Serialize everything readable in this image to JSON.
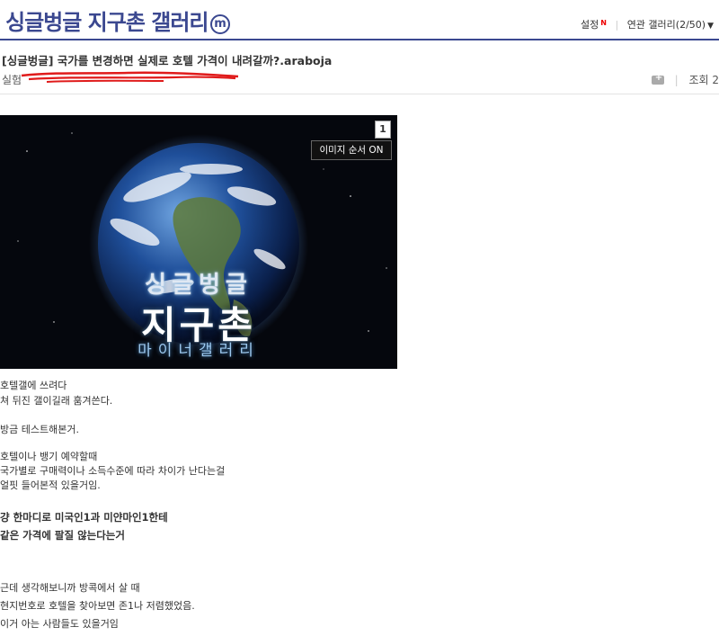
{
  "header": {
    "gallery_title": "싱글벙글 지구촌 갤러리",
    "badge": "m",
    "settings": "설정",
    "new_mark": "N",
    "related": "연관 갤러리(2/50)"
  },
  "post": {
    "title": "[싱글벙글] 국가를 변경하면 실제로 호텔 가격이 내려갈까?.araboja",
    "writer": "실험",
    "views": "조회 2"
  },
  "image": {
    "number": "1",
    "order_button": "이미지 순서 ON",
    "logo_line1": "싱글벙글",
    "logo_line2": "지구촌",
    "logo_line3": "마이너갤러리"
  },
  "content": {
    "p1": "호텔갤에 쓰려다",
    "p2": "쳐 뒤진 갤이길래 훔겨쓴다.",
    "p3": "방금 테스트해본거.",
    "p4": "호텔이나 뱅기 예약할때",
    "p5": "국가별로 구매력이나 소득수준에 따라 차이가 난다는걸",
    "p6": "얼핏 들어본적 있을거임.",
    "p7": "걍 한마디로 미국인1과 미얀마인1한테",
    "p8": "같은 가격에 팔질 않는다는거",
    "p9": "근데 생각해보니까 방콕에서 살 때",
    "p10": "현지번호로 호텔을 찾아보면 존1나 저렴했었음.",
    "p11": "이거 아는 사람들도 있을거임"
  }
}
